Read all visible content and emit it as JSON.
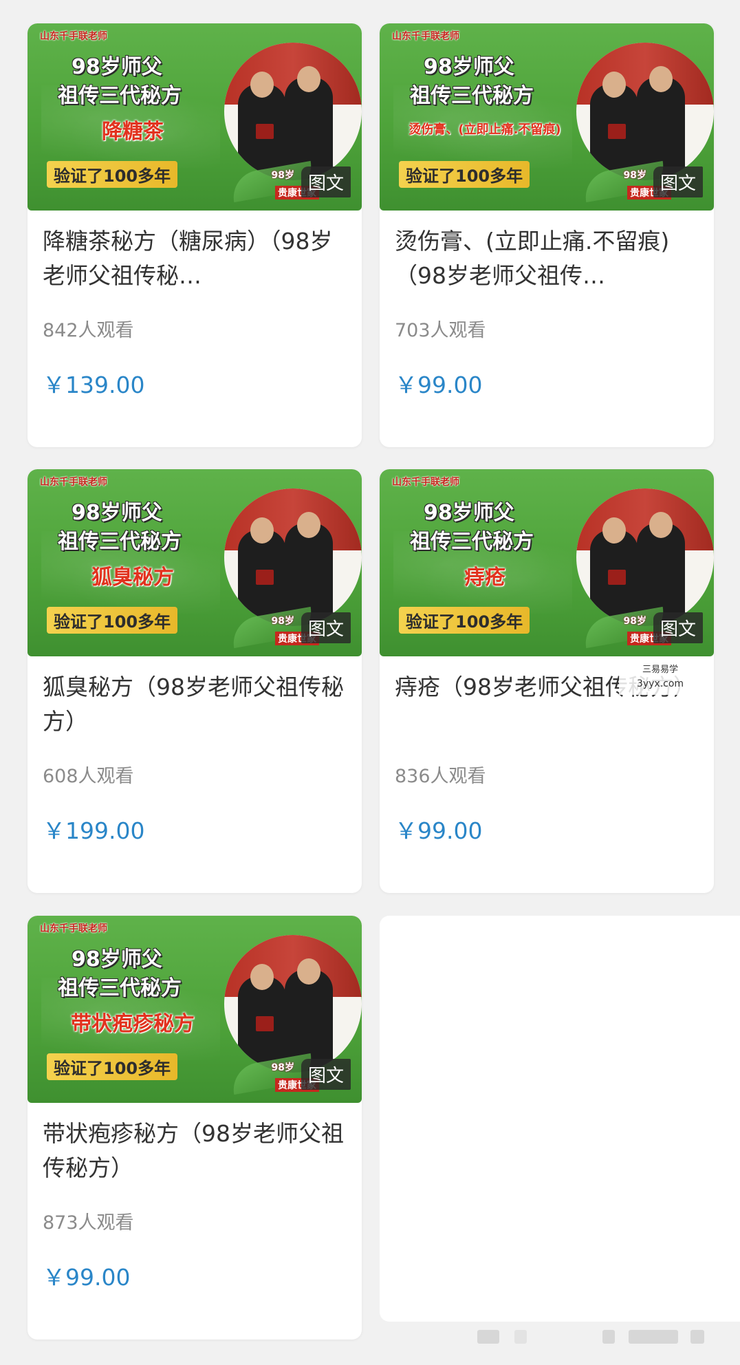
{
  "products": [
    {
      "thumb": {
        "shop": "山东千手联老师",
        "line1": "98岁师父",
        "line2": "祖传三代秘方",
        "product": "降糖茶",
        "verified": "验证了100多年",
        "brand98": "98岁",
        "brand_name": "贵康世家",
        "badge": "图文"
      },
      "title": "降糖茶秘方（糖尿病）（98岁老师父祖传秘…",
      "views": "842人观看",
      "price": "￥139.00"
    },
    {
      "thumb": {
        "shop": "山东千手联老师",
        "line1": "98岁师父",
        "line2": "祖传三代秘方",
        "product": "烫伤膏、(立即止痛.不留痕)",
        "verified": "验证了100多年",
        "brand98": "98岁",
        "brand_name": "贵康世家",
        "badge": "图文"
      },
      "title": "烫伤膏、(立即止痛.不留痕)（98岁老师父祖传…",
      "views": "703人观看",
      "price": "￥99.00"
    },
    {
      "thumb": {
        "shop": "山东千手联老师",
        "line1": "98岁师父",
        "line2": "祖传三代秘方",
        "product": "狐臭秘方",
        "verified": "验证了100多年",
        "brand98": "98岁",
        "brand_name": "贵康世家",
        "badge": "图文"
      },
      "title": "狐臭秘方（98岁老师父祖传秘方）",
      "views": "608人观看",
      "price": "￥199.00"
    },
    {
      "thumb": {
        "shop": "山东千手联老师",
        "line1": "98岁师父",
        "line2": "祖传三代秘方",
        "product": "痔疮",
        "verified": "验证了100多年",
        "brand98": "98岁",
        "brand_name": "贵康世家",
        "badge": "图文"
      },
      "title": "痔疮（98岁老师父祖传秘方）",
      "views": "836人观看",
      "price": "￥99.00"
    },
    {
      "thumb": {
        "shop": "山东千手联老师",
        "line1": "98岁师父",
        "line2": "祖传三代秘方",
        "product": "带状疱疹秘方",
        "verified": "验证了100多年",
        "brand98": "98岁",
        "brand_name": "贵康世家",
        "badge": "图文"
      },
      "title": "带状疱疹秘方（98岁老师父祖传秘方）",
      "views": "873人观看",
      "price": "￥99.00"
    }
  ],
  "watermark": {
    "line1": "三易易学",
    "line2": "3yyx.com"
  },
  "colors": {
    "price": "#2a86c8",
    "thumb_green": "#4ea33a",
    "views": "#8b8b8b"
  }
}
